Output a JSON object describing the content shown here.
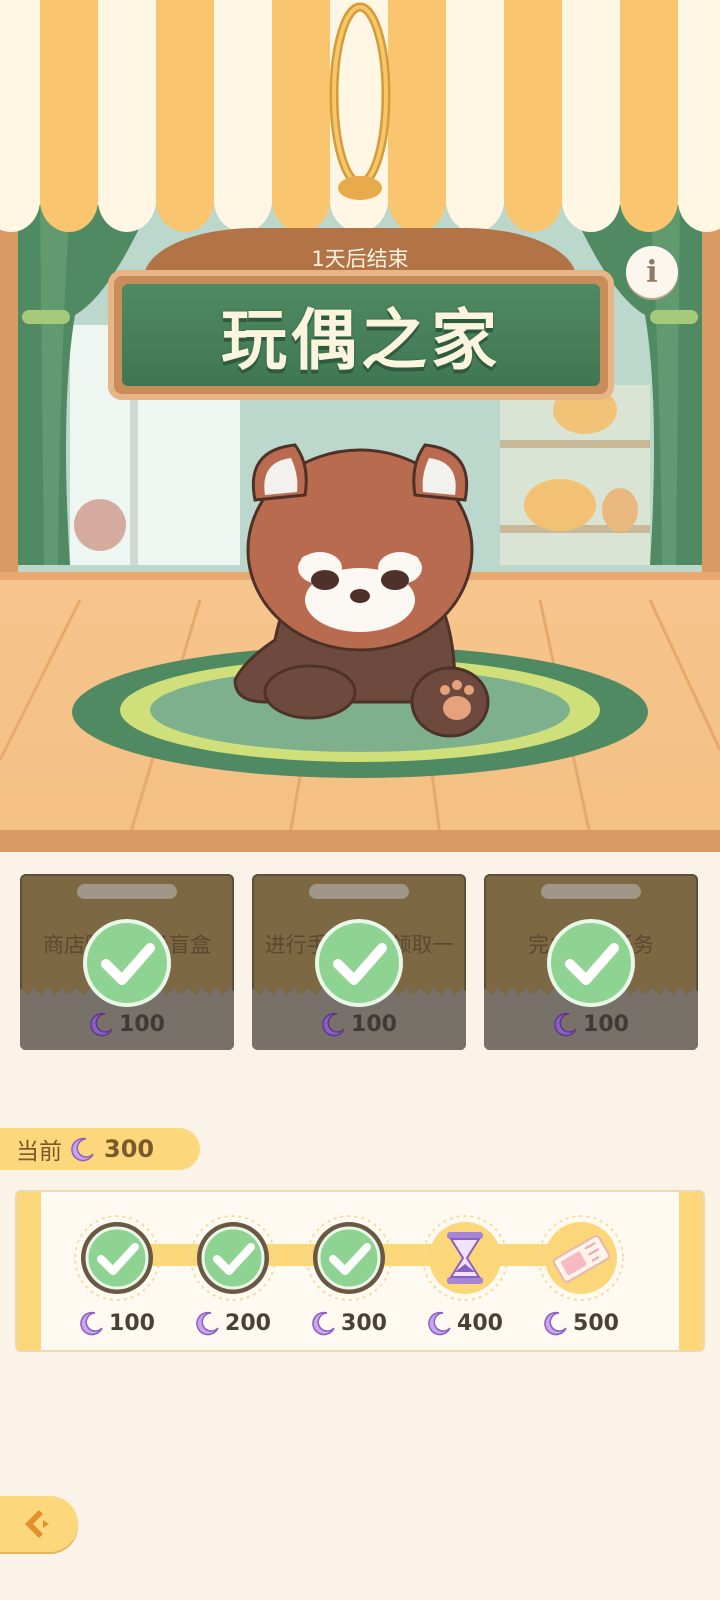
{
  "event": {
    "countdown": "1天后结束",
    "title": "玩偶之家"
  },
  "tasks": [
    {
      "text": "商店陈列高级盲盒",
      "reward": "100",
      "completed": true
    },
    {
      "text": "进行手工制作领取一",
      "reward": "100",
      "completed": true
    },
    {
      "text": "完成每日任务",
      "reward": "100",
      "completed": true
    }
  ],
  "progress": {
    "label": "当前",
    "value": "300",
    "milestones": [
      {
        "amount": "100",
        "state": "claimed",
        "icon": "check-icon"
      },
      {
        "amount": "200",
        "state": "claimed",
        "icon": "check-icon"
      },
      {
        "amount": "300",
        "state": "claimed",
        "icon": "check-icon"
      },
      {
        "amount": "400",
        "state": "reward",
        "icon": "hourglass-icon"
      },
      {
        "amount": "500",
        "state": "reward",
        "icon": "ticket-icon"
      }
    ]
  },
  "colors": {
    "accent": "#fcd77c",
    "sign_green": "#4f8a62",
    "check_green": "#8fd392",
    "moon_purple": "#8c5fc4"
  }
}
